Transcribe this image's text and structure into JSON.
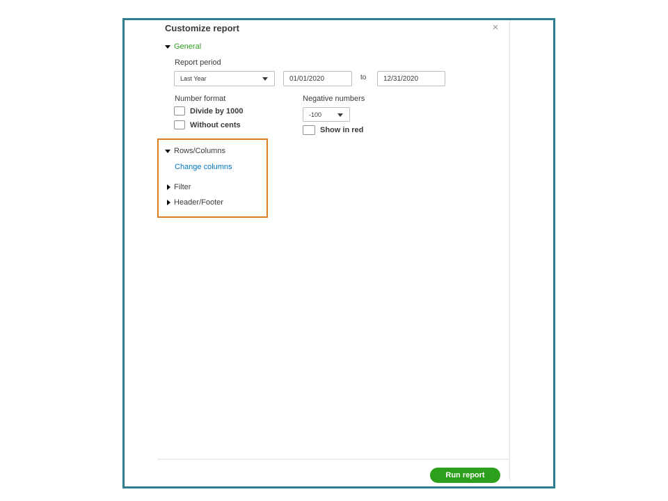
{
  "dialog": {
    "title": "Customize report",
    "close_glyph": "×"
  },
  "general": {
    "section_label": "General",
    "report_period_label": "Report period",
    "period_select_value": "Last Year",
    "start_date": "01/01/2020",
    "to_label": "to",
    "end_date": "12/31/2020",
    "number_format_label": "Number format",
    "divide_label": "Divide by 1000",
    "without_cents_label": "Without cents",
    "negative_numbers_label": "Negative numbers",
    "negative_select_value": "-100",
    "show_in_red_label": "Show in red"
  },
  "rows_columns": {
    "section_label": "Rows/Columns",
    "change_columns_link": "Change columns"
  },
  "filter": {
    "section_label": "Filter"
  },
  "header_footer": {
    "section_label": "Header/Footer"
  },
  "footer": {
    "run_report_label": "Run report"
  },
  "colors": {
    "accent_green": "#2ca01c",
    "link_blue": "#0077c5",
    "frame_teal": "#2e7d8c",
    "highlight_orange": "#e07b1f"
  }
}
